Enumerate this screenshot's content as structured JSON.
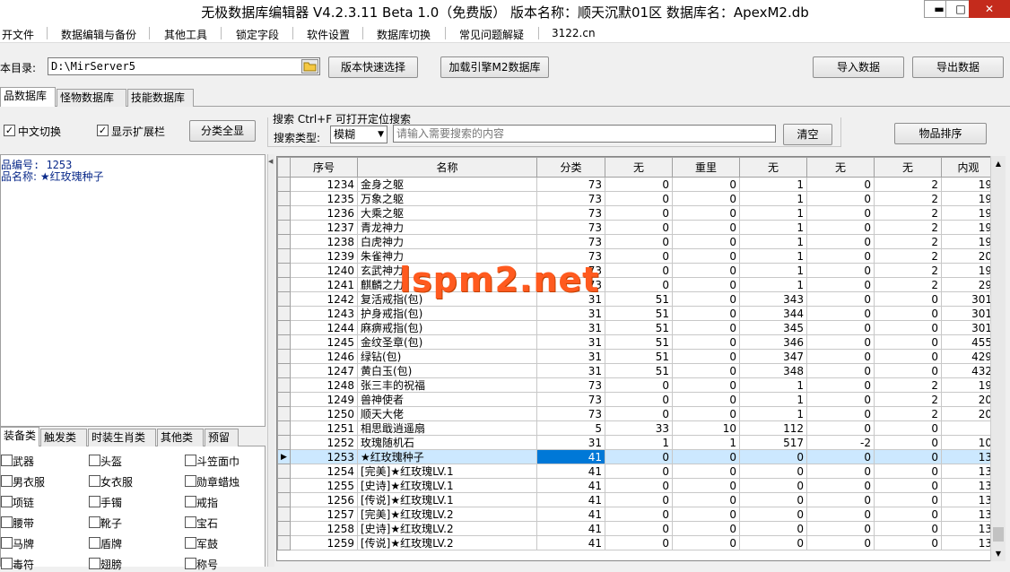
{
  "window": {
    "title": "无极数据库编辑器 V4.2.3.11    Beta 1.0（免费版）    版本名称：顺天沉默01区    数据库名：ApexM2.db",
    "minimize": "▬",
    "maximize": "□",
    "close": "✕"
  },
  "menu": [
    "开文件",
    "数据编辑与备份",
    "其他工具",
    "锁定字段",
    "软件设置",
    "数据库切换",
    "常见问题解疑",
    "3122.cn"
  ],
  "toolbar": {
    "dir_label": "本目录:",
    "dir_value": "D:\\MirServer5",
    "version_button": "版本快速选择",
    "load_button": "加载引擎M2数据库",
    "import_button": "导入数据",
    "export_button": "导出数据"
  },
  "db_tabs": [
    "品数据库",
    "怪物数据库",
    "技能数据库"
  ],
  "options": {
    "chinese_toggle": "中文切换",
    "show_ext": "显示扩展栏",
    "show_all_button": "分类全显",
    "search_title": "搜索   Ctrl+F 可打开定位搜索",
    "search_type_label": "搜索类型:",
    "search_type_value": "模糊",
    "search_placeholder": "请输入需要搜索的内容",
    "clear_button": "清空",
    "sort_button": "物品排序"
  },
  "item_info": {
    "id_line": "品编号: 1253",
    "name_line": "品名称: ★红玫瑰种子"
  },
  "category_tabs": [
    "装备类",
    "触发类",
    "时装生肖类",
    "其他类",
    "预留"
  ],
  "categories": [
    [
      "武器",
      "头盔",
      "斗笠面巾"
    ],
    [
      "男衣服",
      "女衣服",
      "勋章蜡烛"
    ],
    [
      "项链",
      "手镯",
      "戒指"
    ],
    [
      "腰带",
      "靴子",
      "宝石"
    ],
    [
      "马牌",
      "盾牌",
      "军鼓"
    ],
    [
      "毒符",
      "翅膀",
      "称号"
    ]
  ],
  "watermark": "lspm2.net",
  "grid": {
    "columns": [
      "序号",
      "名称",
      "分类",
      "无",
      "重里",
      "无",
      "无",
      "无",
      "内观"
    ],
    "rows": [
      [
        "1234",
        "金身之躯",
        "73",
        "0",
        "0",
        "1",
        "0",
        "2",
        "19"
      ],
      [
        "1235",
        "万象之躯",
        "73",
        "0",
        "0",
        "1",
        "0",
        "2",
        "19"
      ],
      [
        "1236",
        "大乘之躯",
        "73",
        "0",
        "0",
        "1",
        "0",
        "2",
        "19"
      ],
      [
        "1237",
        "青龙神力",
        "73",
        "0",
        "0",
        "1",
        "0",
        "2",
        "19"
      ],
      [
        "1238",
        "白虎神力",
        "73",
        "0",
        "0",
        "1",
        "0",
        "2",
        "19"
      ],
      [
        "1239",
        "朱雀神力",
        "73",
        "0",
        "0",
        "1",
        "0",
        "2",
        "20"
      ],
      [
        "1240",
        "玄武神力",
        "73",
        "0",
        "0",
        "1",
        "0",
        "2",
        "19"
      ],
      [
        "1241",
        "麒麟之力",
        "73",
        "0",
        "0",
        "1",
        "0",
        "2",
        "29"
      ],
      [
        "1242",
        "复活戒指(包)",
        "31",
        "51",
        "0",
        "343",
        "0",
        "0",
        "301"
      ],
      [
        "1243",
        "护身戒指(包)",
        "31",
        "51",
        "0",
        "344",
        "0",
        "0",
        "301"
      ],
      [
        "1244",
        "麻痹戒指(包)",
        "31",
        "51",
        "0",
        "345",
        "0",
        "0",
        "301"
      ],
      [
        "1245",
        "金纹圣章(包)",
        "31",
        "51",
        "0",
        "346",
        "0",
        "0",
        "455"
      ],
      [
        "1246",
        "绿钻(包)",
        "31",
        "51",
        "0",
        "347",
        "0",
        "0",
        "429"
      ],
      [
        "1247",
        "黄白玉(包)",
        "31",
        "51",
        "0",
        "348",
        "0",
        "0",
        "432"
      ],
      [
        "1248",
        "张三丰的祝福",
        "73",
        "0",
        "0",
        "1",
        "0",
        "2",
        "19"
      ],
      [
        "1249",
        "兽神使者",
        "73",
        "0",
        "0",
        "1",
        "0",
        "2",
        "20"
      ],
      [
        "1250",
        "顺天大佬",
        "73",
        "0",
        "0",
        "1",
        "0",
        "2",
        "20"
      ],
      [
        "1251",
        "相思戢逍遥扇",
        "5",
        "33",
        "10",
        "112",
        "0",
        "0",
        ""
      ],
      [
        "1252",
        "玫瑰随机石",
        "31",
        "1",
        "1",
        "517",
        "-2",
        "0",
        "10"
      ],
      [
        "1253",
        "★红玫瑰种子",
        "41",
        "0",
        "0",
        "0",
        "0",
        "0",
        "13"
      ],
      [
        "1254",
        "[完美]★红玫瑰LV.1",
        "41",
        "0",
        "0",
        "0",
        "0",
        "0",
        "13"
      ],
      [
        "1255",
        "[史诗]★红玫瑰LV.1",
        "41",
        "0",
        "0",
        "0",
        "0",
        "0",
        "13"
      ],
      [
        "1256",
        "[传说]★红玫瑰LV.1",
        "41",
        "0",
        "0",
        "0",
        "0",
        "0",
        "13"
      ],
      [
        "1257",
        "[完美]★红玫瑰LV.2",
        "41",
        "0",
        "0",
        "0",
        "0",
        "0",
        "13"
      ],
      [
        "1258",
        "[史诗]★红玫瑰LV.2",
        "41",
        "0",
        "0",
        "0",
        "0",
        "0",
        "13"
      ],
      [
        "1259",
        "[传说]★红玫瑰LV.2",
        "41",
        "0",
        "0",
        "0",
        "0",
        "0",
        "13"
      ]
    ],
    "selected_row": 19,
    "selection_color": "#0078d7",
    "row_marker": "▶"
  },
  "icons": {
    "folder": "folder-icon",
    "dropdown": "chevron-down-icon",
    "scroll_up": "▲",
    "scroll_down": "▼"
  }
}
